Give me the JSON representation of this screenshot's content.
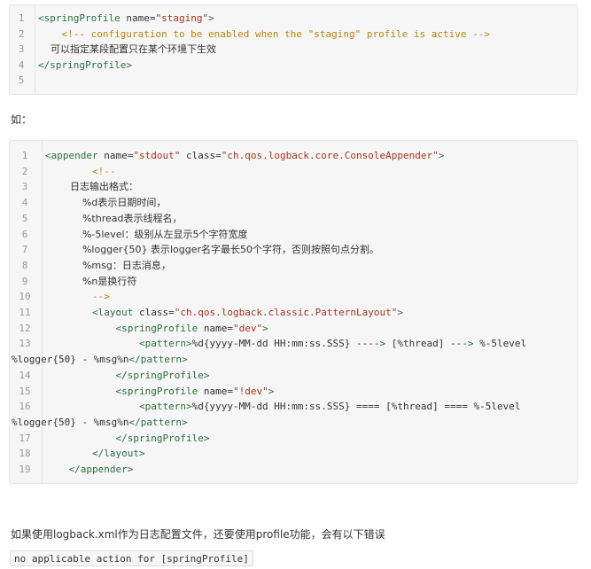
{
  "block1": {
    "lines": [
      {
        "n": "1",
        "a": "<springProfile ",
        "b": "name=",
        "c": "\"staging\"",
        "d": ">"
      },
      {
        "n": "2",
        "text": "    <!-- configuration to be enabled when the \"staging\" profile is active -->"
      },
      {
        "n": "3",
        "text": "    可以指定某段配置只在某个环境下生效"
      },
      {
        "n": "4",
        "text": "</springProfile>"
      },
      {
        "n": "5",
        "text": ""
      }
    ]
  },
  "para1": "如：",
  "block2": {
    "lines": [
      {
        "n": "1",
        "text": "<appender name=\"stdout\" class=\"ch.qos.logback.core.ConsoleAppender\">"
      },
      {
        "n": "2",
        "text": "        <!--"
      },
      {
        "n": "3",
        "text": "        日志输出格式："
      },
      {
        "n": "4",
        "text": "            %d表示日期时间，"
      },
      {
        "n": "5",
        "text": "            %thread表示线程名，"
      },
      {
        "n": "6",
        "text": "            %-5level：级别从左显示5个字符宽度"
      },
      {
        "n": "7",
        "text": "            %logger{50} 表示logger名字最长50个字符，否则按照句点分割。"
      },
      {
        "n": "8",
        "text": "            %msg：日志消息，"
      },
      {
        "n": "9",
        "text": "            %n是换行符"
      },
      {
        "n": "10",
        "text": "        -->"
      },
      {
        "n": "11",
        "text": "        <layout class=\"ch.qos.logback.classic.PatternLayout\">"
      },
      {
        "n": "12",
        "text": "            <springProfile name=\"dev\">"
      },
      {
        "n": "13",
        "text": "                <pattern>%d{yyyy-MM-dd HH:mm:ss.SSS} ----> [%thread] ---> %-5level",
        "wrap": "%logger{50} - %msg%n</pattern>"
      },
      {
        "n": "14",
        "text": "            </springProfile>"
      },
      {
        "n": "15",
        "text": "            <springProfile name=\"!dev\">"
      },
      {
        "n": "16",
        "text": "                <pattern>%d{yyyy-MM-dd HH:mm:ss.SSS} ==== [%thread] ==== %-5level",
        "wrap": "%logger{50} - %msg%n</pattern>"
      },
      {
        "n": "17",
        "text": "            </springProfile>"
      },
      {
        "n": "18",
        "text": "        </layout>"
      },
      {
        "n": "19",
        "text": "    </appender>"
      }
    ]
  },
  "para2": "如果使用logback.xml作为日志配置文件，还要使用profile功能，会有以下错误",
  "error_code": "no applicable action for [springProfile]",
  "colors": {
    "tag": "#2a6f40",
    "attribute": "#2438a8",
    "string": "#a2341c",
    "comment": "#b8860b",
    "background": "#f6f6f6"
  }
}
